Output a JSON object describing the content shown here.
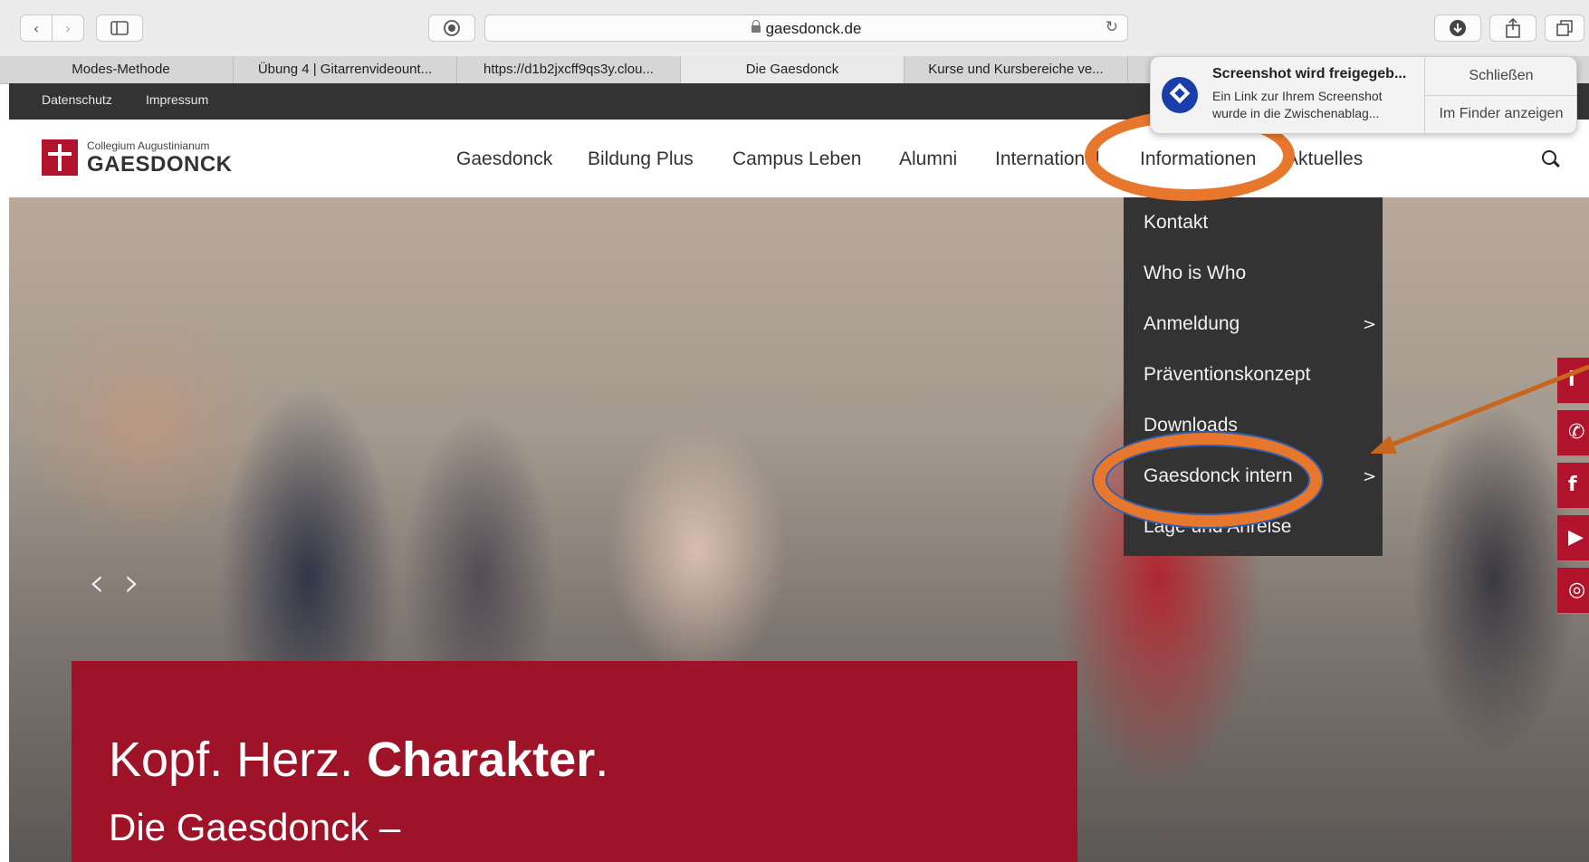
{
  "browser": {
    "url": "gaesdonck.de",
    "icons": [
      "chevron-left-icon",
      "chevron-right-icon",
      "sidebar-icon",
      "privacy-icon",
      "lock-icon",
      "reload-icon",
      "download-icon",
      "share-icon",
      "tabs-icon"
    ],
    "tabs": [
      {
        "label": "Modes-Methode",
        "active": false
      },
      {
        "label": "Übung 4 | Gitarrenvideount...",
        "active": false
      },
      {
        "label": "https://d1b2jxcff9qs3y.clou...",
        "active": false
      },
      {
        "label": "Die Gaesdonck",
        "active": true
      },
      {
        "label": "Kurse und Kursbereiche ve...",
        "active": false
      }
    ]
  },
  "notification": {
    "title": "Screenshot wird freigegeb...",
    "body": "Ein Link zur Ihrem Screenshot wurde in die Zwischenablag...",
    "close_label": "Schließen",
    "finder_label": "Im Finder anzeigen"
  },
  "utility_links": {
    "privacy": "Datenschutz",
    "imprint": "Impressum"
  },
  "logo": {
    "subtitle": "Collegium Augustinianum",
    "title": "GAESDONCK"
  },
  "nav": {
    "items": [
      "Gaesdonck",
      "Bildung Plus",
      "Campus Leben",
      "Alumni",
      "International",
      "Informationen",
      "Aktuelles"
    ]
  },
  "dropdown": {
    "items": [
      {
        "label": "Kontakt",
        "submenu": false
      },
      {
        "label": "Who is Who",
        "submenu": false
      },
      {
        "label": "Anmeldung",
        "submenu": true
      },
      {
        "label": "Präventionskonzept",
        "submenu": false
      },
      {
        "label": "Downloads",
        "submenu": false
      },
      {
        "label": "Gaesdonck intern",
        "submenu": true
      },
      {
        "label": "Lage und Anreise",
        "submenu": false
      }
    ],
    "chevron": ">"
  },
  "hero": {
    "prev": "‹",
    "next": "›",
    "headline_part1": "Kopf. Herz. ",
    "headline_bold": "Charakter",
    "headline_end": ".",
    "subline": "Die Gaesdonck –"
  },
  "social": [
    {
      "icon": "info-icon",
      "glyph": "i"
    },
    {
      "icon": "phone-icon",
      "glyph": "✆"
    },
    {
      "icon": "facebook-icon",
      "glyph": "f"
    },
    {
      "icon": "youtube-icon",
      "glyph": "▶"
    },
    {
      "icon": "instagram-icon",
      "glyph": "◎"
    }
  ],
  "colors": {
    "brand_red": "#b1122c",
    "hero_panel": "#9e1328",
    "dark_bar": "#333333",
    "annotation_orange": "#e8772e",
    "annotation_blue": "#2f5fb3"
  }
}
